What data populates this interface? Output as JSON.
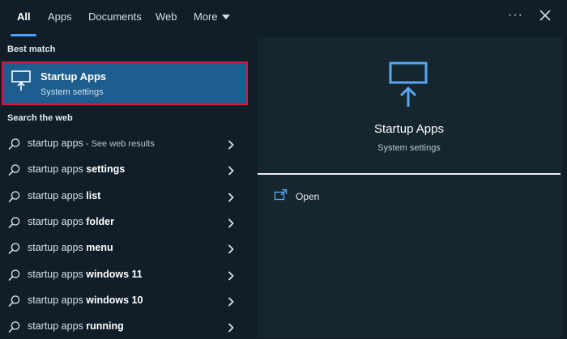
{
  "tabs": [
    {
      "label": "All",
      "active": true
    },
    {
      "label": "Apps"
    },
    {
      "label": "Documents"
    },
    {
      "label": "Web"
    },
    {
      "label": "More"
    }
  ],
  "header": {
    "more_icon": "ellipsis-icon",
    "close_icon": "close-icon"
  },
  "best_match": {
    "section_label": "Best match",
    "title": "Startup Apps",
    "subtitle": "System settings",
    "icon": "monitor-arrow-icon"
  },
  "web": {
    "section_label": "Search the web",
    "items": [
      {
        "prefix": "startup apps",
        "bold": "",
        "hint": " - See web results"
      },
      {
        "prefix": "startup apps ",
        "bold": "settings",
        "hint": ""
      },
      {
        "prefix": "startup apps ",
        "bold": "list",
        "hint": ""
      },
      {
        "prefix": "startup apps ",
        "bold": "folder",
        "hint": ""
      },
      {
        "prefix": "startup apps ",
        "bold": "menu",
        "hint": ""
      },
      {
        "prefix": "startup apps ",
        "bold": "windows 11",
        "hint": ""
      },
      {
        "prefix": "startup apps ",
        "bold": "windows 10",
        "hint": ""
      },
      {
        "prefix": "startup apps ",
        "bold": "running",
        "hint": ""
      }
    ]
  },
  "preview": {
    "title": "Startup Apps",
    "subtitle": "System settings",
    "actions": [
      {
        "label": "Open",
        "icon": "open-window-icon"
      }
    ]
  },
  "colors": {
    "accent": "#4ca3ff",
    "selection": "#1e5e8e",
    "highlight_border": "#cc1f3a",
    "background": "#0f1e29"
  }
}
